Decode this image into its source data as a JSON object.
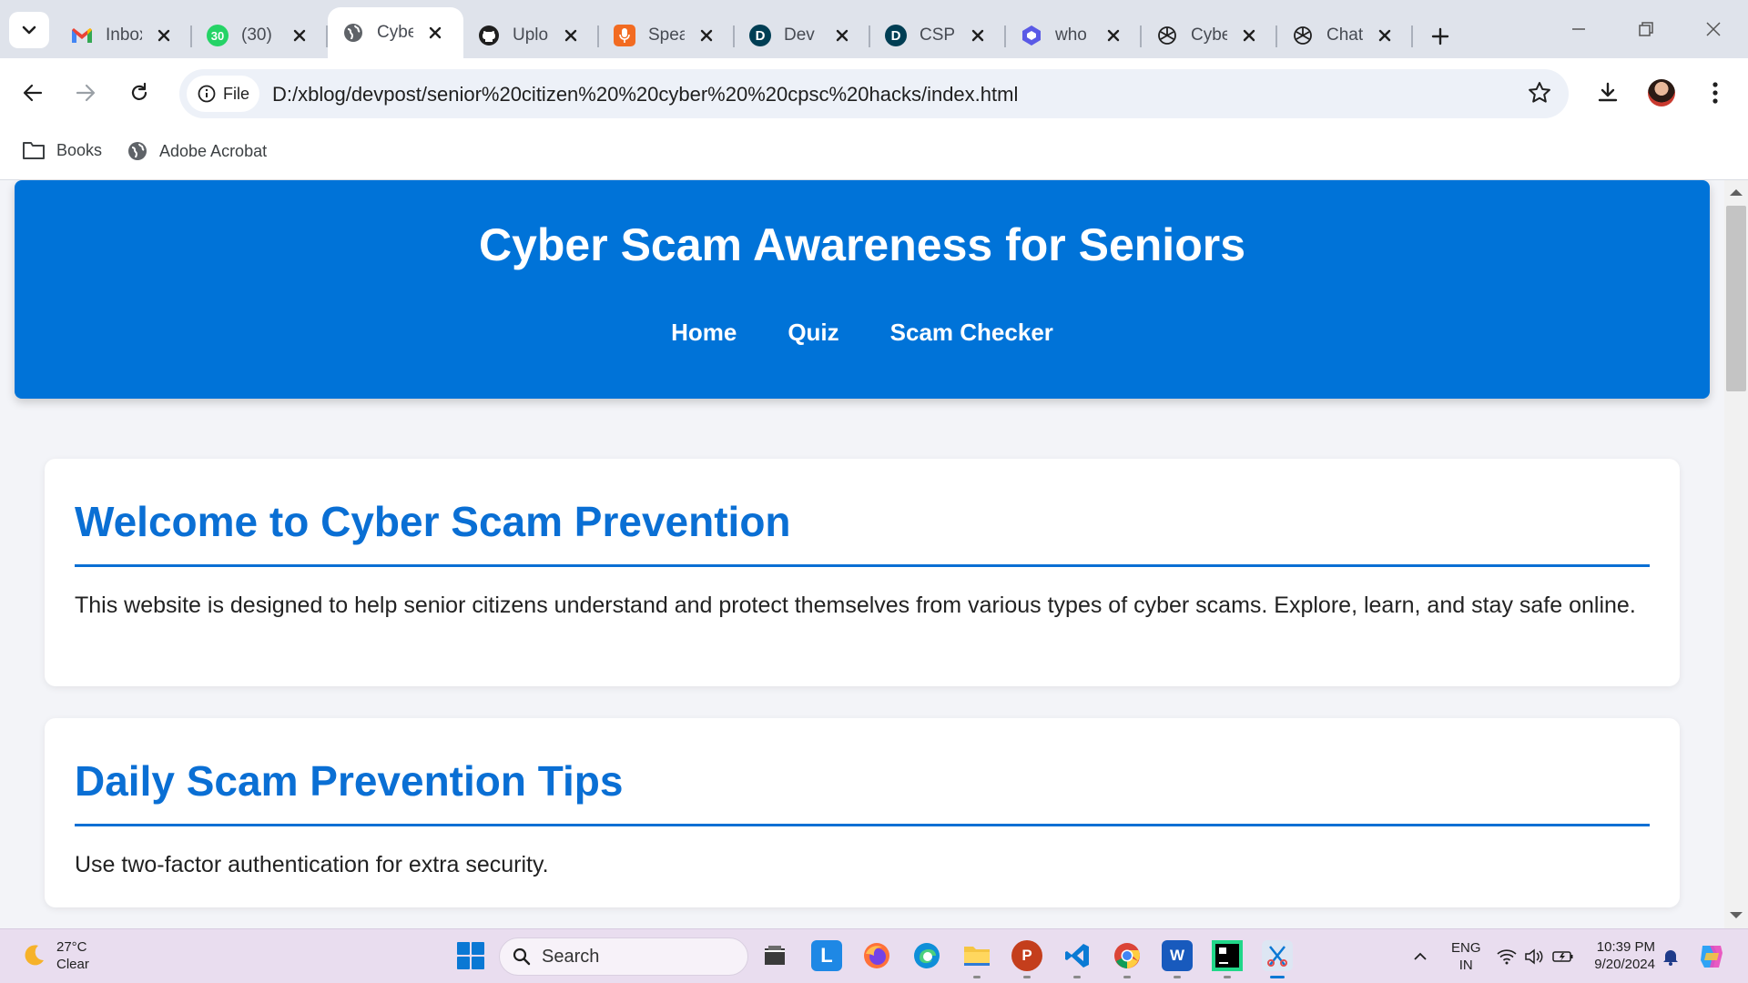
{
  "browser": {
    "tabs": [
      {
        "title": "Inbox",
        "favicon": "gmail-icon",
        "color": "#ea4335"
      },
      {
        "title": "(30)",
        "favicon": "whatsapp-icon",
        "color": "#25d366",
        "badge": "30"
      },
      {
        "title": "Cyber",
        "favicon": "globe-icon",
        "color": "#555555",
        "active": true
      },
      {
        "title": "Upload",
        "favicon": "github-icon",
        "color": "#1f1f1f"
      },
      {
        "title": "Speak",
        "favicon": "microphone-icon",
        "color": "#f26b21"
      },
      {
        "title": "Dev",
        "favicon": "devpost-icon",
        "color": "#003e54"
      },
      {
        "title": "CSPC",
        "favicon": "devpost-icon",
        "color": "#003e54"
      },
      {
        "title": "who",
        "favicon": "copilot-icon",
        "color": "#5a5ae6"
      },
      {
        "title": "Cyber",
        "favicon": "openai-icon",
        "color": "#1f1f1f"
      },
      {
        "title": "Chat",
        "favicon": "openai-icon",
        "color": "#1f1f1f"
      }
    ],
    "address_chip": "File",
    "url": "D:/xblog/devpost/senior%20citizen%20%20cyber%20%20cpsc%20hacks/index.html",
    "bookmarks": [
      {
        "label": "Books",
        "icon": "folder-icon"
      },
      {
        "label": "Adobe Acrobat",
        "icon": "globe-icon"
      }
    ]
  },
  "site": {
    "title": "Cyber Scam Awareness for Seniors",
    "nav": [
      "Home",
      "Quiz",
      "Scam Checker"
    ],
    "accent": "#0073d8",
    "sections": [
      {
        "heading": "Welcome to Cyber Scam Prevention",
        "text": "This website is designed to help senior citizens understand and protect themselves from various types of cyber scams. Explore, learn, and stay safe online."
      },
      {
        "heading": "Daily Scam Prevention Tips",
        "text": "Use two-factor authentication for extra security."
      }
    ]
  },
  "taskbar": {
    "weather_temp": "27°C",
    "weather_desc": "Clear",
    "search_label": "Search",
    "apps": [
      "file-explorer-icon",
      "l-app-icon",
      "firefox-icon",
      "edge-icon",
      "folder-icon",
      "powerpoint-icon",
      "vscode-icon",
      "chrome-icon",
      "word-icon",
      "pycharm-icon",
      "snipping-tool-icon"
    ],
    "lang_top": "ENG",
    "lang_bottom": "IN",
    "time": "10:39 PM",
    "date": "9/20/2024"
  }
}
